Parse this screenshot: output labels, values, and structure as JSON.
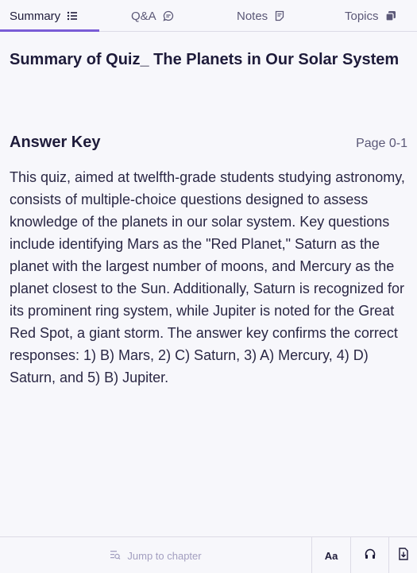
{
  "tabs": [
    {
      "label": "Summary",
      "icon": "list-icon",
      "active": true
    },
    {
      "label": "Q&A",
      "icon": "chat-bubble-icon",
      "active": false
    },
    {
      "label": "Notes",
      "icon": "note-icon",
      "active": false
    },
    {
      "label": "Topics",
      "icon": "stack-icon",
      "active": false
    }
  ],
  "document": {
    "title": "Summary of Quiz_ The Planets in Our Solar System"
  },
  "section": {
    "title": "Answer Key",
    "page_indicator": "Page 0-1",
    "body": "This quiz, aimed at twelfth-grade students studying astronomy, consists of multiple-choice questions designed to assess knowledge of the planets in our solar system. Key questions include identifying Mars as the \"Red Planet,\" Saturn as the planet with the largest number of moons, and Mercury as the planet closest to the Sun. Additionally, Saturn is recognized for its prominent ring system, while Jupiter is noted for the Great Red Spot, a giant storm. The answer key confirms the correct responses: 1) B) Mars, 2) C) Saturn, 3) A) Mercury, 4) D) Saturn, and 5) B) Jupiter."
  },
  "bottom_bar": {
    "jump_label": "Jump to chapter",
    "font_button_label": "Aa",
    "icons": [
      "jump-chapter-icon",
      "font-size-icon",
      "headphones-icon",
      "download-icon"
    ]
  },
  "colors": {
    "accent": "#7a5cd6",
    "text": "#1e1b3a",
    "muted": "#a39fc0",
    "background": "#f7f7fb"
  }
}
